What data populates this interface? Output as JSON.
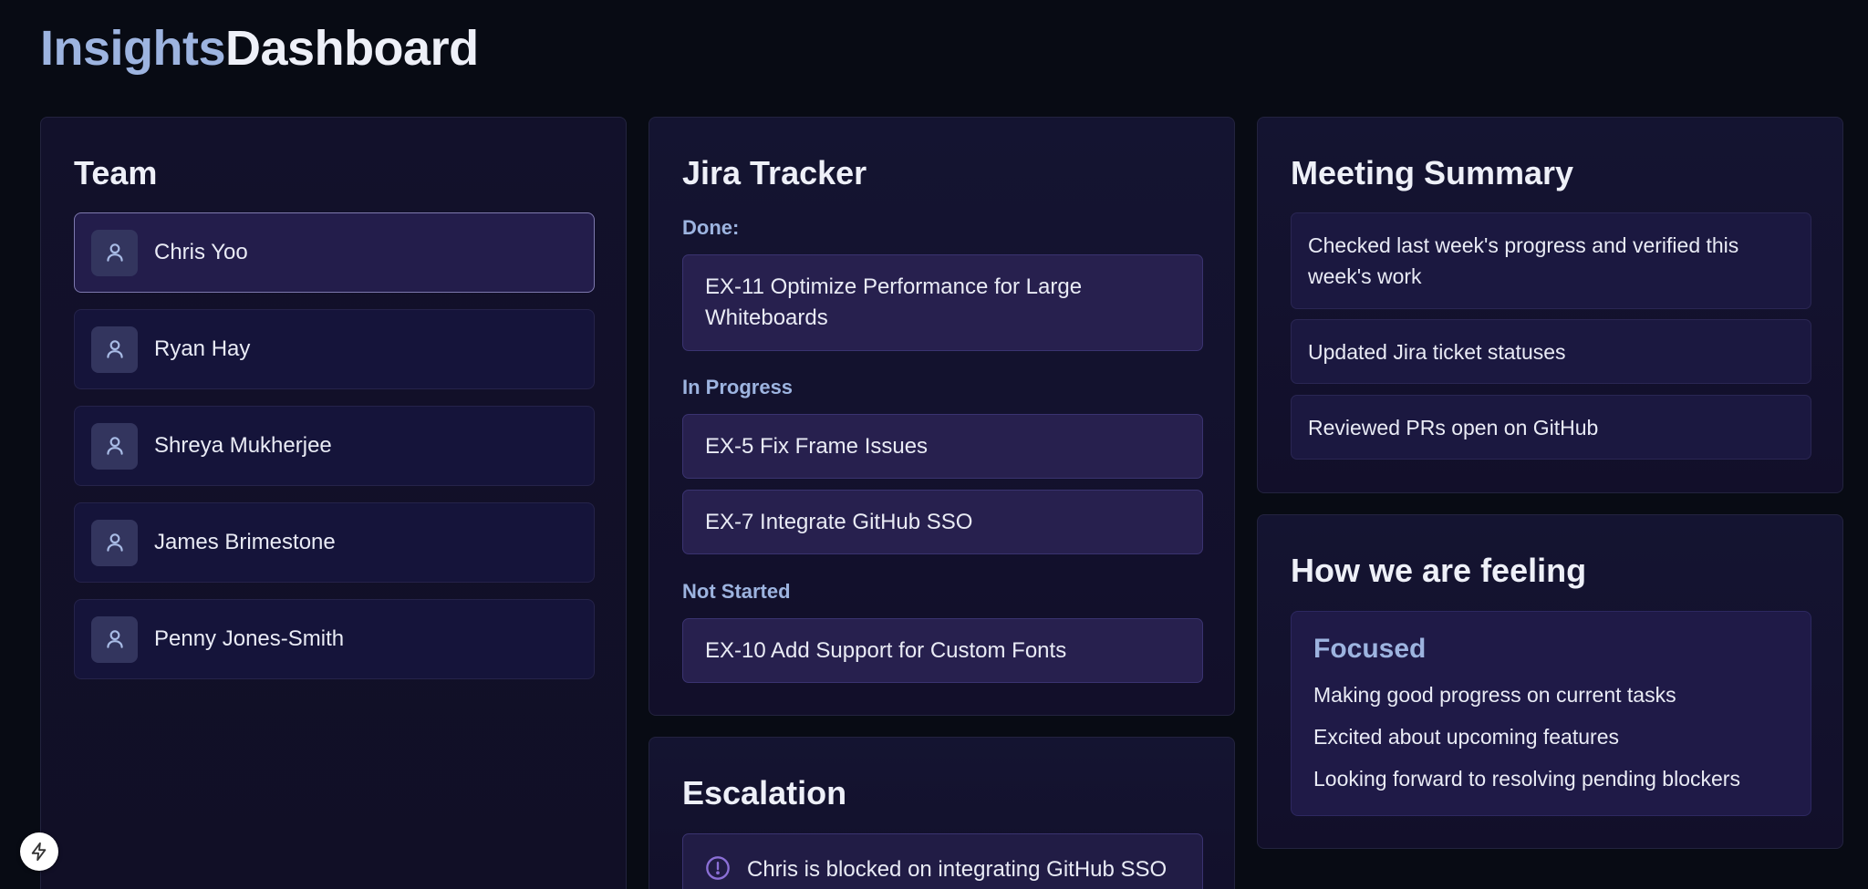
{
  "header": {
    "title_part1": "Insights",
    "title_part2": "Dashboard"
  },
  "team": {
    "title": "Team",
    "members": [
      {
        "name": "Chris Yoo",
        "selected": true
      },
      {
        "name": "Ryan Hay",
        "selected": false
      },
      {
        "name": "Shreya Mukherjee",
        "selected": false
      },
      {
        "name": "James Brimestone",
        "selected": false
      },
      {
        "name": "Penny Jones-Smith",
        "selected": false
      }
    ]
  },
  "jira": {
    "title": "Jira Tracker",
    "done_label": "Done:",
    "done": [
      "EX-11 Optimize Performance for Large Whiteboards"
    ],
    "in_progress_label": "In Progress",
    "in_progress": [
      "EX-5 Fix Frame Issues",
      "EX-7 Integrate GitHub SSO"
    ],
    "not_started_label": "Not Started",
    "not_started": [
      "EX-10 Add Support for Custom Fonts"
    ]
  },
  "escalation": {
    "title": "Escalation",
    "items": [
      "Chris is blocked on integrating GitHub SSO"
    ]
  },
  "meeting": {
    "title": "Meeting Summary",
    "notes": [
      "Checked last week's progress and verified this week's work",
      "Updated Jira ticket statuses",
      "Reviewed PRs open on GitHub"
    ]
  },
  "feeling": {
    "title": "How we are feeling",
    "mood": "Focused",
    "lines": [
      "Making good progress on current tasks",
      "Excited about upcoming features",
      "Looking forward to resolving pending blockers"
    ]
  },
  "colors": {
    "background": "#080b14",
    "accent": "#9db4e0",
    "card": "#141431",
    "ticket": "#27204e"
  },
  "icons": {
    "member": "user-icon",
    "escalation": "alert-circle-icon",
    "dev_badge": "lightning-icon"
  }
}
